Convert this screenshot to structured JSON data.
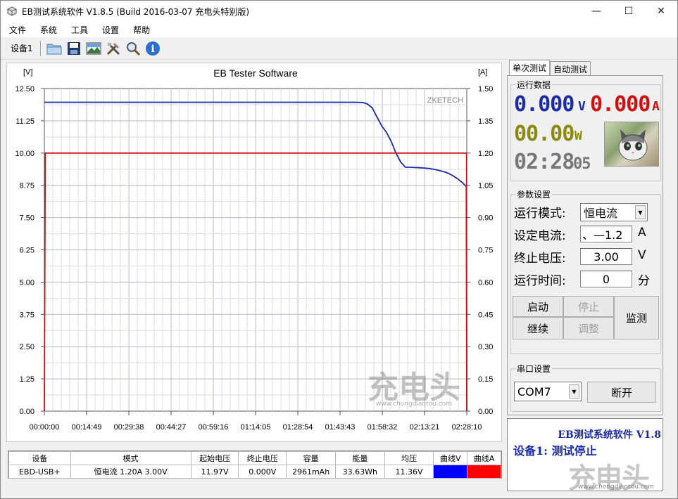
{
  "window": {
    "title": "EB测试系统软件 V1.8.5 (Build 2016-03-07 充电头特别版)",
    "minimize_glyph": "—",
    "maximize_glyph": "☐",
    "close_glyph": "✕"
  },
  "menu": {
    "items": [
      "文件",
      "系统",
      "工具",
      "设置",
      "帮助"
    ]
  },
  "toolbar": {
    "device_label": "设备1",
    "icons": [
      "open-folder-icon",
      "save-icon",
      "picture-icon",
      "tools-icon",
      "search-icon",
      "info-icon"
    ]
  },
  "chart_data": {
    "type": "line",
    "title": "EB Tester Software",
    "watermark": "ZKETECH",
    "y_left_unit": "[V]",
    "y_right_unit": "[A]",
    "ylim_left": [
      0,
      12.5
    ],
    "ylim_right": [
      0,
      1.5
    ],
    "y_left_ticks": [
      "12.50",
      "11.25",
      "10.00",
      "8.75",
      "7.50",
      "6.25",
      "5.00",
      "3.75",
      "2.50",
      "1.25",
      "0.00"
    ],
    "y_right_ticks": [
      "1.50",
      "1.35",
      "1.20",
      "1.05",
      "0.90",
      "0.75",
      "0.60",
      "0.45",
      "0.30",
      "0.15",
      "0.00"
    ],
    "x_ticks": [
      "00:00:00",
      "00:14:49",
      "00:29:38",
      "00:44:27",
      "00:59:16",
      "01:14:05",
      "01:28:54",
      "01:43:43",
      "01:58:32",
      "02:13:21",
      "02:28:10"
    ],
    "xlim_seconds": [
      0,
      8890
    ],
    "grid": true,
    "series": [
      {
        "name": "曲线V",
        "color": "#1a2aa8",
        "axis": "left",
        "x": [
          0,
          6500,
          6700,
          6800,
          6900,
          7000,
          7100,
          7200,
          7300,
          7400,
          7500,
          7600,
          7700,
          7800,
          7900,
          8000,
          8100,
          8200,
          8300,
          8400,
          8500,
          8600,
          8700,
          8800,
          8880,
          8890
        ],
        "values": [
          11.97,
          11.97,
          11.96,
          11.9,
          11.75,
          11.4,
          11.05,
          10.8,
          10.45,
          10.0,
          9.65,
          9.45,
          9.45,
          9.44,
          9.43,
          9.42,
          9.4,
          9.37,
          9.33,
          9.28,
          9.22,
          9.12,
          9.0,
          8.85,
          8.7,
          0.0
        ]
      },
      {
        "name": "曲线A",
        "color": "#cc1111",
        "axis": "right",
        "x": [
          0,
          20,
          8885,
          8890
        ],
        "values": [
          0.0,
          1.2,
          1.2,
          0.0
        ]
      }
    ]
  },
  "table": {
    "headers": [
      "设备",
      "模式",
      "起始电压",
      "终止电压",
      "容量",
      "能量",
      "均压",
      "曲线V",
      "曲线A"
    ],
    "row": [
      "EBD-USB+",
      "恒电流  1.20A  3.00V",
      "11.97V",
      "0.000V",
      "2961mAh",
      "33.63Wh",
      "11.36V",
      "",
      ""
    ],
    "curve_v_color": "#0000ff",
    "curve_a_color": "#ff0000"
  },
  "right": {
    "tabs": [
      "单次测试",
      "自动测试"
    ],
    "run_data_title": "运行数据",
    "voltage": "0.000",
    "voltage_unit": "V",
    "current": "0.000",
    "current_unit": "A",
    "power": "00.00",
    "power_unit": "W",
    "time": "02:28",
    "time_sec": "05",
    "params_title": "参数设置",
    "mode_label": "运行模式:",
    "mode_value": "恒电流",
    "set_current_label": "设定电流:",
    "set_current_value": "、—1.2",
    "set_current_unit": "A",
    "stop_voltage_label": "终止电压:",
    "stop_voltage_value": "3.00",
    "stop_voltage_unit": "V",
    "run_time_label": "运行时间:",
    "run_time_value": "0",
    "run_time_unit": "分",
    "btn_start": "启动",
    "btn_stop": "停止",
    "btn_continue": "继续",
    "btn_adjust": "调整",
    "btn_monitor": "监测",
    "serial_title": "串口设置",
    "com_value": "COM7",
    "btn_disconnect": "断开",
    "status_line1": "EB测试系统软件 V1.8",
    "status_line2": "设备1: 测试停止"
  },
  "watermark_brand": "充电头",
  "watermark_url": "www.chongdiantou.com"
}
